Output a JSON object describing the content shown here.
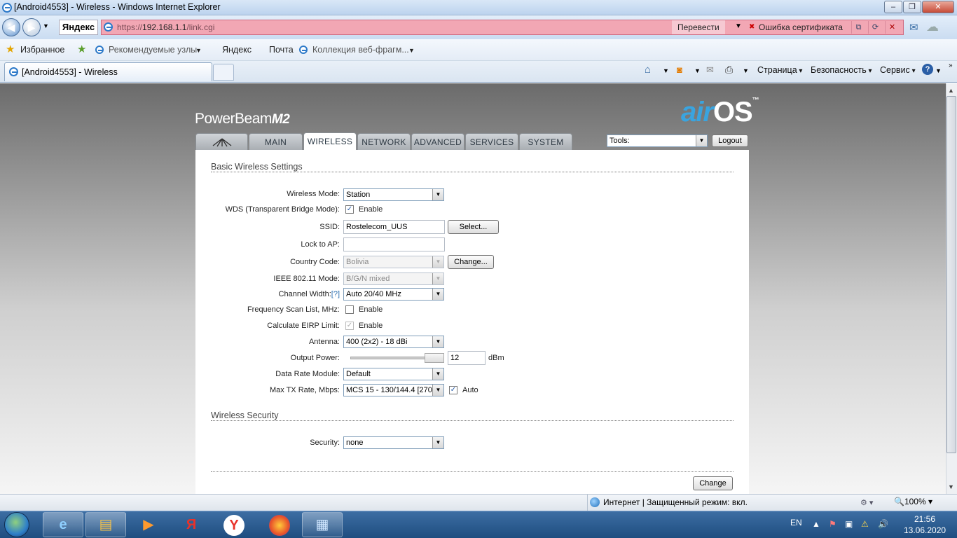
{
  "window": {
    "title": "[Android4553] - Wireless - Windows Internet Explorer"
  },
  "address": {
    "search_brand": "Яндекс",
    "url_scheme": "https://",
    "url_host": "192.168.1.1",
    "url_path": "/link.cgi",
    "translate": "Перевести",
    "cert_error": "Ошибка сертификата"
  },
  "favorites": {
    "label": "Избранное",
    "items": [
      "Рекомендуемые узлы",
      "Яндекс",
      "Почта",
      "Коллекция веб-фрагм..."
    ]
  },
  "tab": {
    "title": "[Android4553] - Wireless"
  },
  "commands": {
    "page": "Страница",
    "security": "Безопасность",
    "service": "Сервис"
  },
  "device": {
    "model": "PowerBeam",
    "model_suffix": "M2",
    "os_air": "air",
    "os_os": "OS",
    "tm": "™"
  },
  "nav": {
    "tabs": [
      "MAIN",
      "WIRELESS",
      "NETWORK",
      "ADVANCED",
      "SERVICES",
      "SYSTEM"
    ],
    "active": "WIRELESS"
  },
  "tools": {
    "label": "Tools:",
    "logout": "Logout"
  },
  "basic": {
    "heading": "Basic Wireless Settings",
    "wireless_mode": {
      "label": "Wireless Mode:",
      "value": "Station"
    },
    "wds": {
      "label": "WDS (Transparent Bridge Mode):",
      "checked": true,
      "option": "Enable"
    },
    "ssid": {
      "label": "SSID:",
      "value": "Rostelecom_UUS",
      "button": "Select..."
    },
    "lock_ap": {
      "label": "Lock to AP:",
      "value": ""
    },
    "country": {
      "label": "Country Code:",
      "value": "Bolivia",
      "button": "Change..."
    },
    "ieee_mode": {
      "label": "IEEE 802.11 Mode:",
      "value": "B/G/N mixed"
    },
    "channel_width": {
      "label": "Channel Width:",
      "help": "[?]",
      "value": "Auto 20/40 MHz"
    },
    "freq_scan": {
      "label": "Frequency Scan List, MHz:",
      "checked": false,
      "option": "Enable"
    },
    "eirp": {
      "label": "Calculate EIRP Limit:",
      "checked": true,
      "option": "Enable"
    },
    "antenna": {
      "label": "Antenna:",
      "value": "400 (2x2) - 18 dBi"
    },
    "output_power": {
      "label": "Output Power:",
      "value": "12",
      "unit": "dBm"
    },
    "data_rate": {
      "label": "Data Rate Module:",
      "value": "Default"
    },
    "max_tx": {
      "label": "Max TX Rate, Mbps:",
      "value": "MCS 15 - 130/144.4 [270/",
      "auto_checked": true,
      "auto": "Auto"
    }
  },
  "security": {
    "heading": "Wireless Security",
    "label": "Security:",
    "value": "none"
  },
  "change_button": "Change",
  "status": {
    "zone": "Интернет | Защищенный режим: вкл.",
    "zoom": "100%"
  },
  "taskbar": {
    "lang": "EN",
    "time": "21:56",
    "date": "13.06.2020"
  }
}
